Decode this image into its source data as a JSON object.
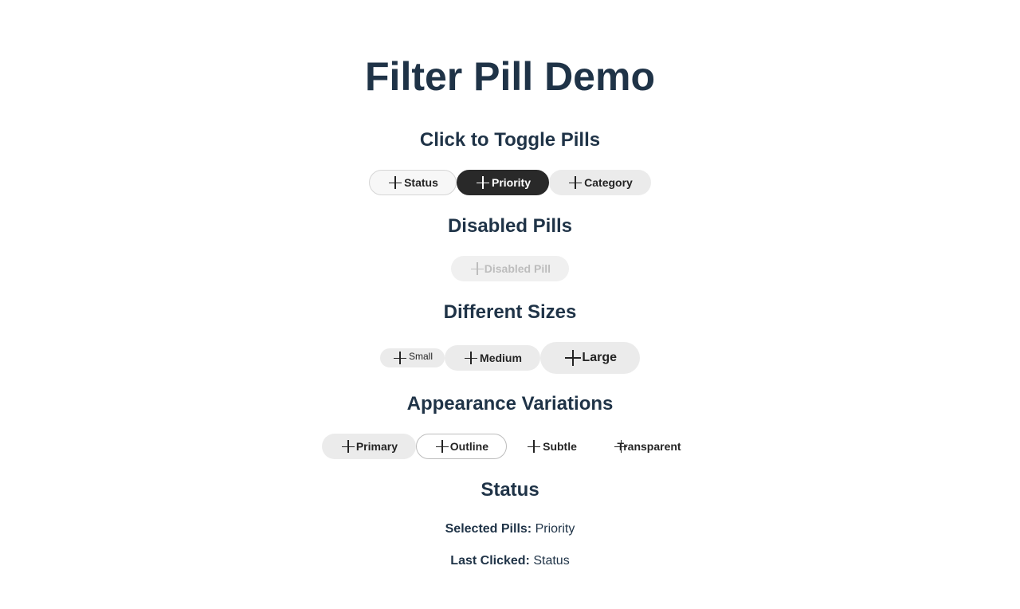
{
  "title": "Filter Pill Demo",
  "sections": {
    "toggle": {
      "heading": "Click to Toggle Pills",
      "pills": [
        {
          "label": "Status",
          "state": "unselected"
        },
        {
          "label": "Priority",
          "state": "selected"
        },
        {
          "label": "Category",
          "state": "unselected"
        }
      ]
    },
    "disabled": {
      "heading": "Disabled Pills",
      "pills": [
        {
          "label": "Disabled Pill",
          "state": "disabled"
        }
      ]
    },
    "sizes": {
      "heading": "Different Sizes",
      "pills": [
        {
          "label": "Small",
          "size": "small"
        },
        {
          "label": "Medium",
          "size": "medium"
        },
        {
          "label": "Large",
          "size": "large"
        }
      ]
    },
    "appearance": {
      "heading": "Appearance Variations",
      "pills": [
        {
          "label": "Primary",
          "appearance": "primary"
        },
        {
          "label": "Outline",
          "appearance": "outline"
        },
        {
          "label": "Subtle",
          "appearance": "subtle"
        },
        {
          "label": "Transparent",
          "appearance": "transparent"
        }
      ]
    },
    "status": {
      "heading": "Status",
      "selected_key": "Selected Pills:",
      "selected_value": "Priority",
      "last_key": "Last Clicked:",
      "last_value": "Status"
    }
  },
  "icons": {
    "pill_icon": "plus-icon"
  },
  "colors": {
    "heading_text": "#1f3347",
    "pill_bg": "#ebebeb",
    "pill_selected_bg": "#292929",
    "pill_disabled_text": "#bdbdbd"
  }
}
